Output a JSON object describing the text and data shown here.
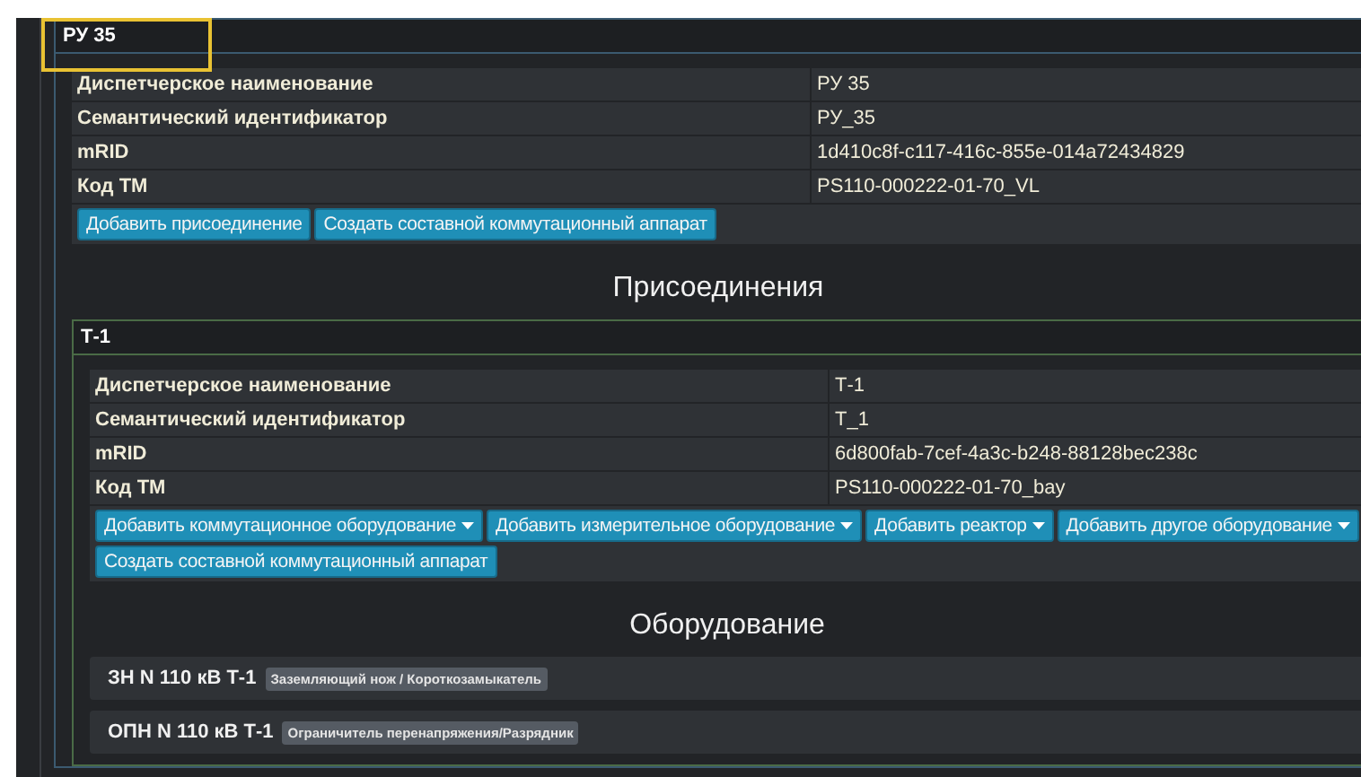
{
  "panel": {
    "title": "РУ 35",
    "highlighted": true,
    "properties": [
      {
        "label": "Диспетчерское наименование",
        "value": "РУ 35"
      },
      {
        "label": "Семантический идентификатор",
        "value": "РУ_35"
      },
      {
        "label": "mRID",
        "value": "1d410c8f-c117-416c-855e-014a72434829"
      },
      {
        "label": "Код ТМ",
        "value": "PS110-000222-01-70_VL"
      }
    ],
    "buttons": [
      {
        "label": "Добавить присоединение",
        "dropdown": false
      },
      {
        "label": "Создать составной коммутационный аппарат",
        "dropdown": false
      }
    ],
    "section_heading": "Присоединения",
    "bay": {
      "title": "Т-1",
      "properties": [
        {
          "label": "Диспетчерское наименование",
          "value": "Т-1"
        },
        {
          "label": "Семантический идентификатор",
          "value": "Т_1"
        },
        {
          "label": "mRID",
          "value": "6d800fab-7cef-4a3c-b248-88128bec238c"
        },
        {
          "label": "Код ТМ",
          "value": "PS110-000222-01-70_bay"
        }
      ],
      "buttons": [
        {
          "label": "Добавить коммутационное оборудование",
          "dropdown": true
        },
        {
          "label": "Добавить измерительное оборудование",
          "dropdown": true
        },
        {
          "label": "Добавить реактор",
          "dropdown": true
        },
        {
          "label": "Добавить другое оборудование",
          "dropdown": true
        },
        {
          "label": "Создать составной коммутационный аппарат",
          "dropdown": false
        }
      ],
      "section_heading": "Оборудование",
      "equipment": [
        {
          "name": "ЗН N 110 кВ Т-1",
          "type": "Заземляющий нож / Короткозамыкатель"
        },
        {
          "name": "ОПН N 110 кВ Т-1",
          "type": "Ограничитель перенапряжения/Разрядник"
        }
      ]
    }
  }
}
